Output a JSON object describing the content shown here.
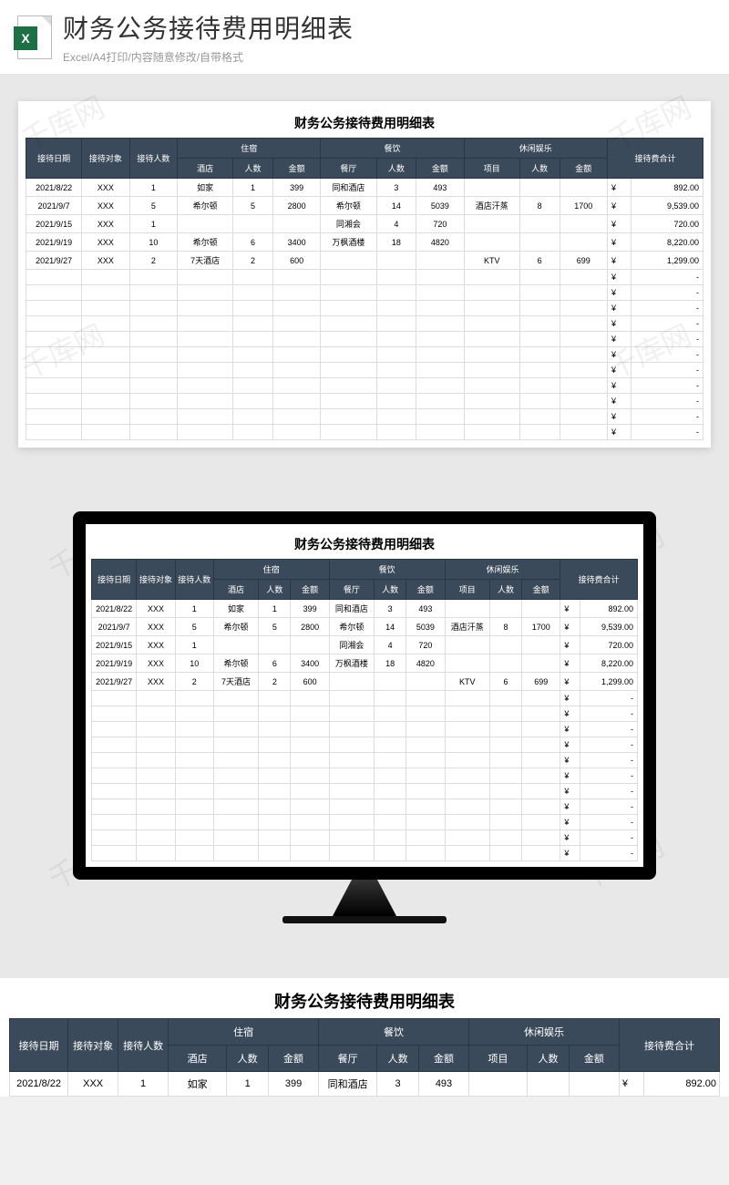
{
  "header": {
    "title": "财务公务接待费用明细表",
    "subtitle": "Excel/A4打印/内容随意修改/自带格式",
    "icon_letter": "X"
  },
  "watermark": "千库网",
  "sheet": {
    "title": "财务公务接待费用明细表",
    "group_headers": {
      "date": "接待日期",
      "target": "接待对象",
      "people": "接待人数",
      "lodging": "住宿",
      "dining": "餐饮",
      "leisure": "休闲娱乐",
      "total": "接待费合计"
    },
    "sub_headers": {
      "hotel": "酒店",
      "l_people": "人数",
      "l_amount": "金额",
      "restaurant": "餐厅",
      "d_people": "人数",
      "d_amount": "金额",
      "project": "项目",
      "e_people": "人数",
      "e_amount": "金额"
    },
    "currency": "¥",
    "empty_total": "-",
    "rows": [
      {
        "date": "2021/8/22",
        "target": "XXX",
        "people": "1",
        "hotel": "如家",
        "lp": "1",
        "la": "399",
        "rest": "同和酒店",
        "dp": "3",
        "da": "493",
        "proj": "",
        "ep": "",
        "ea": "",
        "total": "892.00"
      },
      {
        "date": "2021/9/7",
        "target": "XXX",
        "people": "5",
        "hotel": "希尔顿",
        "lp": "5",
        "la": "2800",
        "rest": "希尔顿",
        "dp": "14",
        "da": "5039",
        "proj": "酒店汗蒸",
        "ep": "8",
        "ea": "1700",
        "total": "9,539.00"
      },
      {
        "date": "2021/9/15",
        "target": "XXX",
        "people": "1",
        "hotel": "",
        "lp": "",
        "la": "",
        "rest": "同湘会",
        "dp": "4",
        "da": "720",
        "proj": "",
        "ep": "",
        "ea": "",
        "total": "720.00"
      },
      {
        "date": "2021/9/19",
        "target": "XXX",
        "people": "10",
        "hotel": "希尔顿",
        "lp": "6",
        "la": "3400",
        "rest": "万枫酒楼",
        "dp": "18",
        "da": "4820",
        "proj": "",
        "ep": "",
        "ea": "",
        "total": "8,220.00"
      },
      {
        "date": "2021/9/27",
        "target": "XXX",
        "people": "2",
        "hotel": "7天酒店",
        "lp": "2",
        "la": "600",
        "rest": "",
        "dp": "",
        "da": "",
        "proj": "KTV",
        "ep": "6",
        "ea": "699",
        "total": "1,299.00"
      }
    ],
    "empty_rows": 11
  },
  "chart_data": {
    "type": "table",
    "title": "财务公务接待费用明细表",
    "columns": [
      "接待日期",
      "接待对象",
      "接待人数",
      "住宿-酒店",
      "住宿-人数",
      "住宿-金额",
      "餐饮-餐厅",
      "餐饮-人数",
      "餐饮-金额",
      "休闲娱乐-项目",
      "休闲娱乐-人数",
      "休闲娱乐-金额",
      "接待费合计"
    ],
    "rows": [
      [
        "2021/8/22",
        "XXX",
        1,
        "如家",
        1,
        399,
        "同和酒店",
        3,
        493,
        "",
        "",
        "",
        892.0
      ],
      [
        "2021/9/7",
        "XXX",
        5,
        "希尔顿",
        5,
        2800,
        "希尔顿",
        14,
        5039,
        "酒店汗蒸",
        8,
        1700,
        9539.0
      ],
      [
        "2021/9/15",
        "XXX",
        1,
        "",
        "",
        "",
        "同湘会",
        4,
        720,
        "",
        "",
        "",
        720.0
      ],
      [
        "2021/9/19",
        "XXX",
        10,
        "希尔顿",
        6,
        3400,
        "万枫酒楼",
        18,
        4820,
        "",
        "",
        "",
        8220.0
      ],
      [
        "2021/9/27",
        "XXX",
        2,
        "7天酒店",
        2,
        600,
        "",
        "",
        "",
        "KTV",
        6,
        699,
        1299.0
      ]
    ]
  }
}
